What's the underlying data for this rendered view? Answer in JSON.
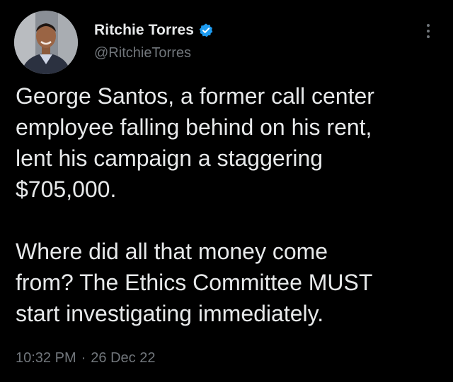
{
  "author": {
    "display_name": "Ritchie Torres",
    "handle": "@RitchieTorres",
    "verified_icon": "verified-badge-icon"
  },
  "tweet": {
    "line1": "George Santos, a former call center",
    "line2": "employee falling behind on his rent,",
    "line3": "lent his campaign a staggering",
    "line4": "$705,000.",
    "line5": "Where did all that money come",
    "line6": "from?  The Ethics Committee MUST",
    "line7": "start investigating immediately."
  },
  "meta": {
    "time": "10:32 PM",
    "separator": "·",
    "date": "26 Dec 22"
  },
  "colors": {
    "background": "#000000",
    "text": "#e7e9ea",
    "secondary": "#71767b",
    "verified": "#1d9bf0"
  }
}
